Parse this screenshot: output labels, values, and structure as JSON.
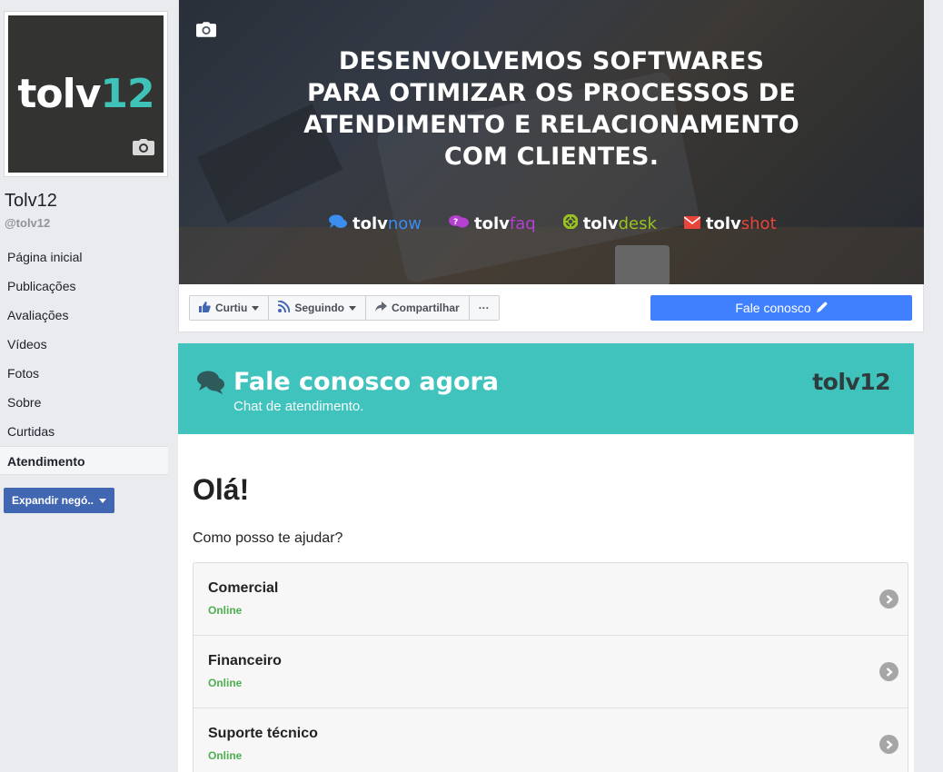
{
  "profile": {
    "logo_part1": "tolv",
    "logo_part2": "12",
    "name": "Tolv12",
    "handle": "@tolv12"
  },
  "nav": [
    {
      "label": "Página inicial"
    },
    {
      "label": "Publicações"
    },
    {
      "label": "Avaliações"
    },
    {
      "label": "Vídeos"
    },
    {
      "label": "Fotos"
    },
    {
      "label": "Sobre"
    },
    {
      "label": "Curtidas"
    },
    {
      "label": "Atendimento"
    }
  ],
  "expand_button": "Expandir negó..",
  "cover": {
    "headline": [
      "DESENVOLVEMOS SOFTWARES",
      "PARA OTIMIZAR OS PROCESSOS DE",
      "ATENDIMENTO E RELACIONAMENTO",
      "COM CLIENTES."
    ],
    "brands": [
      {
        "prefix": "tolv",
        "suffix": "now",
        "color": "#3b8df0",
        "icon": "chat-icon"
      },
      {
        "prefix": "tolv",
        "suffix": "faq",
        "color": "#b43fd1",
        "icon": "faq-icon"
      },
      {
        "prefix": "tolv",
        "suffix": "desk",
        "color": "#98c21f",
        "icon": "lifebuoy-icon"
      },
      {
        "prefix": "tolv",
        "suffix": "shot",
        "color": "#e8443c",
        "icon": "mail-icon"
      }
    ]
  },
  "actions": {
    "like": "Curtiu",
    "follow": "Seguindo",
    "share": "Compartilhar",
    "more": "···",
    "contact": "Fale conosco"
  },
  "chat": {
    "title": "Fale conosco agora",
    "subtitle": "Chat de atendimento.",
    "logo": "tolv12",
    "greeting": "Olá!",
    "help": "Como posso te ajudar?",
    "departments": [
      {
        "name": "Comercial",
        "status": "Online"
      },
      {
        "name": "Financeiro",
        "status": "Online"
      },
      {
        "name": "Suporte técnico",
        "status": "Online"
      }
    ]
  },
  "colors": {
    "facebook_blue": "#4267b2",
    "contact_blue": "#4080ff",
    "chat_teal": "#3fc3bc",
    "online_green": "#4cb050"
  }
}
